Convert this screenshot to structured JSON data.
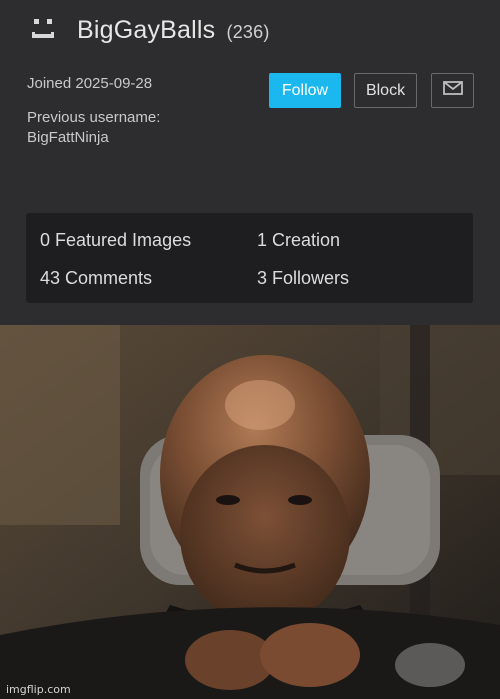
{
  "profile": {
    "username": "BigGayBalls",
    "points": "(236)",
    "joined": "Joined 2025-09-28",
    "previous_label": "Previous username:",
    "previous_name": "BigFattNinja",
    "follow_label": "Follow",
    "block_label": "Block",
    "message_icon": "envelope-icon",
    "avatar_icon": "face-icon"
  },
  "stats": {
    "featured": "0 Featured Images",
    "creations": "1 Creation",
    "comments": "43 Comments",
    "followers": "3 Followers"
  },
  "image": {
    "watermark": "imgflip.com"
  },
  "colors": {
    "accent": "#1ab8ee",
    "panel": "#2d2d2f",
    "stats_bg": "#1e1e20"
  }
}
